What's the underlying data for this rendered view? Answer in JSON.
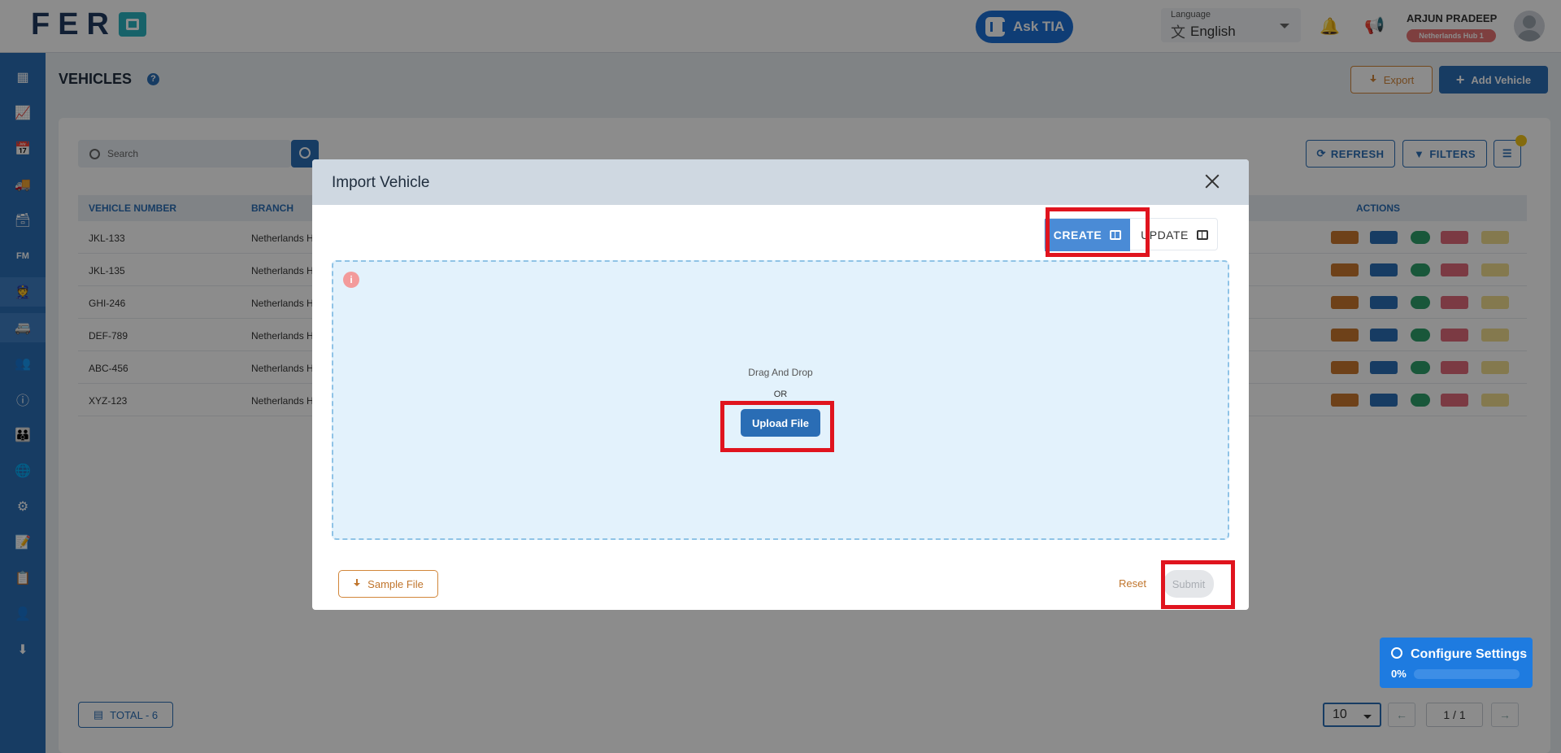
{
  "header": {
    "logo_text": "FER",
    "ask_tia": "Ask TIA",
    "language_caption": "Language",
    "language_value": "English",
    "user_name": "ARJUN PRADEEP",
    "user_hub": "Netherlands Hub 1"
  },
  "sidebar": {
    "fm_label": "FM"
  },
  "page": {
    "title": "VEHICLES",
    "export_label": "Export",
    "add_label": "Add Vehicle",
    "search_placeholder": "Search",
    "refresh_label": "REFRESH",
    "filters_label": "FILTERS"
  },
  "table": {
    "headers": [
      "VEHICLE NUMBER",
      "BRANCH",
      "ACTIONS"
    ],
    "rows": [
      {
        "number": "JKL-133",
        "branch": "Netherlands H"
      },
      {
        "number": "JKL-135",
        "branch": "Netherlands H"
      },
      {
        "number": "GHI-246",
        "branch": "Netherlands H"
      },
      {
        "number": "DEF-789",
        "branch": "Netherlands H"
      },
      {
        "number": "ABC-456",
        "branch": "Netherlands H"
      },
      {
        "number": "XYZ-123",
        "branch": "Netherlands H"
      }
    ]
  },
  "footer": {
    "total": "TOTAL  - 6",
    "per_page": "10",
    "page_indicator": "1 / 1"
  },
  "modal": {
    "title": "Import Vehicle",
    "create_label": "CREATE",
    "update_label": "UPDATE",
    "drag_drop": "Drag And Drop",
    "or": "OR",
    "upload_label": "Upload File",
    "sample_label": "Sample File",
    "reset_label": "Reset",
    "submit_label": "Submit"
  },
  "config": {
    "title": "Configure Settings",
    "percent_label": "0%",
    "progress": 0
  },
  "colors": {
    "primary": "#2a6db5",
    "accent_orange": "#d1863a",
    "highlight_red": "#e0141e"
  }
}
